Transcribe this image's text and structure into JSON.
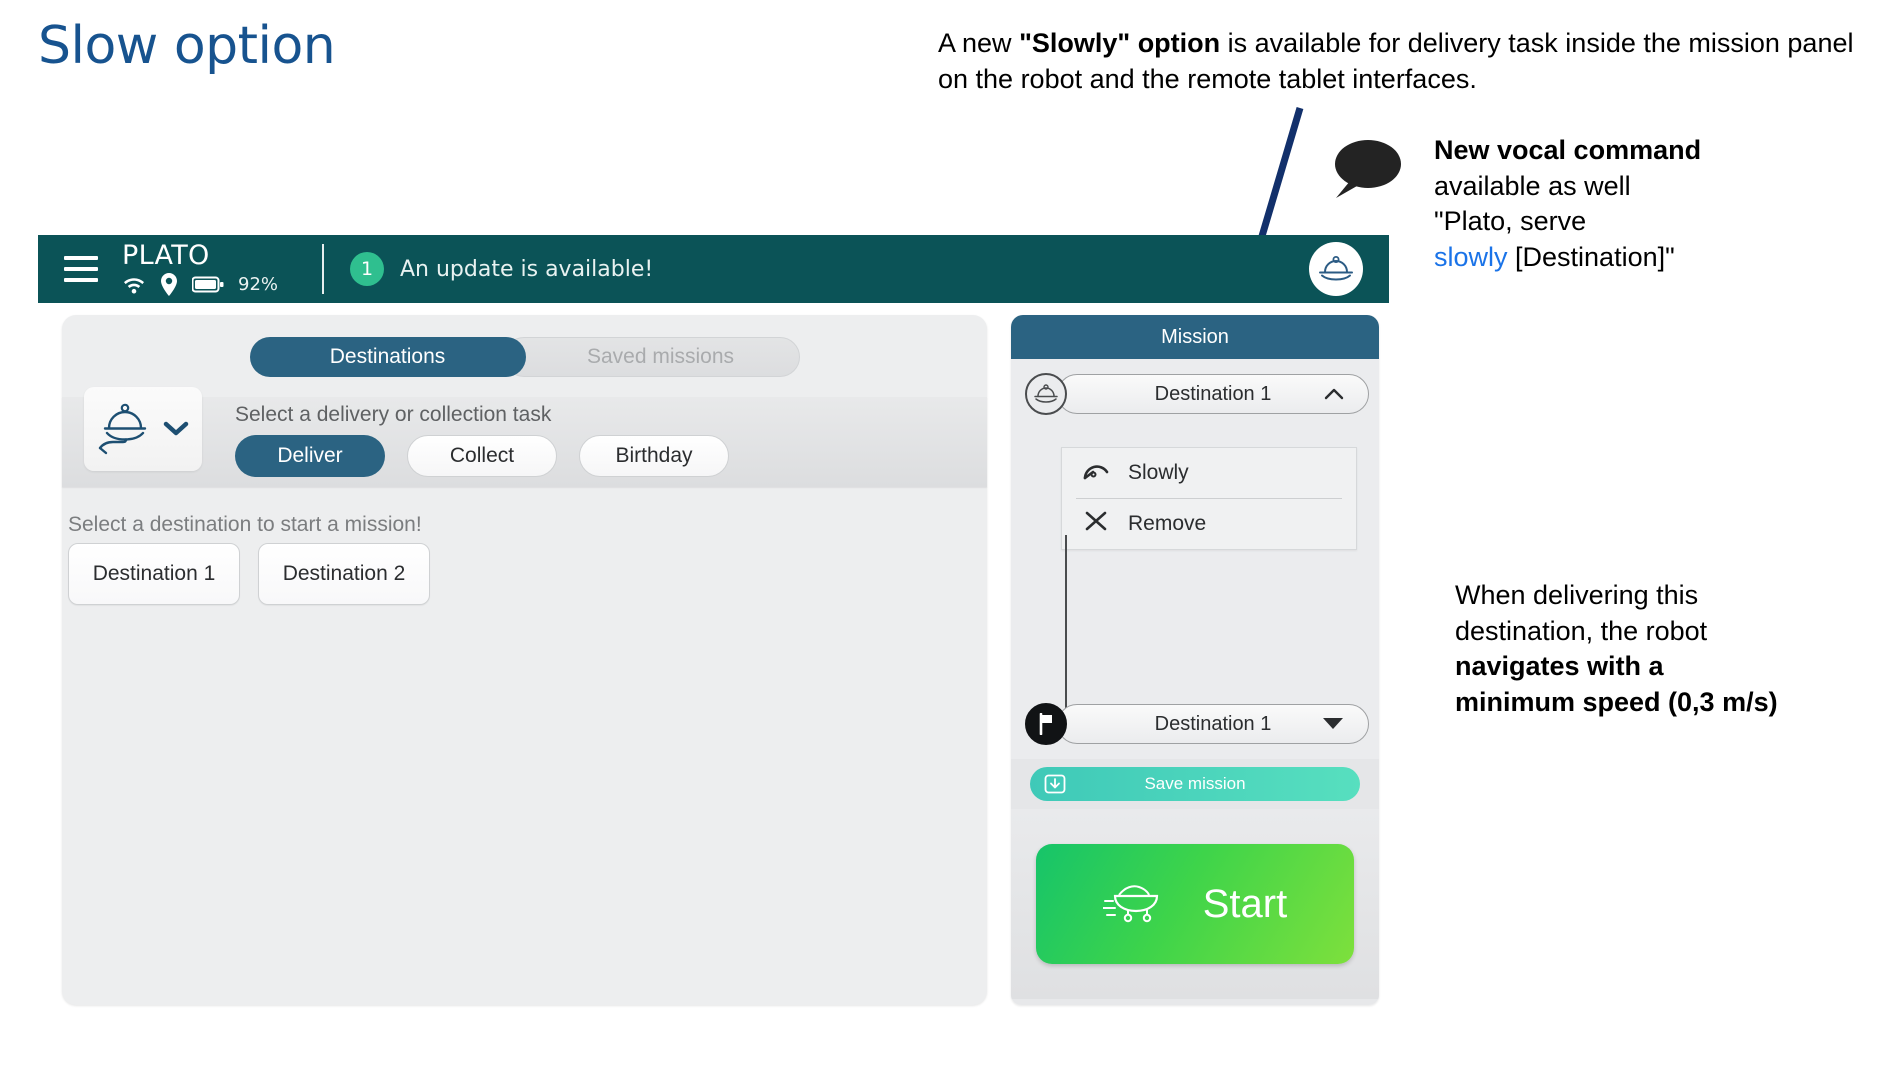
{
  "slide": {
    "title": "Slow option",
    "title_color": "#17538f"
  },
  "annotations": {
    "top_note": {
      "prefix": "A new ",
      "bold": "\"Slowly\" option",
      "suffix": " is available for delivery task inside the mission panel on the robot and the remote tablet interfaces."
    },
    "vocal_note": {
      "icon": "speech-bubble-icon",
      "line1_bold": "New vocal command",
      "line2": "available as well",
      "line3": "\"Plato, serve",
      "line4_blue": "slowly",
      "line4_rest": " [Destination]\"",
      "blue_color": "#1a73e8"
    },
    "bottom_note": {
      "line1": "When delivering this",
      "line2": "destination, the robot",
      "line3_bold": "navigates with a",
      "line4_bold": "minimum speed (0,3 m/s)"
    },
    "arrow": {
      "color": "#12306b",
      "name": "pointer-arrow"
    }
  },
  "app": {
    "header": {
      "menu_icon": "hamburger-menu-icon",
      "brand": "PLATO",
      "wifi_icon": "wifi-icon",
      "location_icon": "location-pin-icon",
      "battery_icon": "battery-icon",
      "battery_level": "92%",
      "update_count": "1",
      "update_text": "An update is available!",
      "avatar_icon": "serving-tray-icon",
      "bg_color": "#0b5357",
      "badge_color": "#2fbf8f"
    },
    "tabs": [
      {
        "label": "Destinations",
        "active": true
      },
      {
        "label": "Saved missions",
        "active": false
      }
    ],
    "task_selector": {
      "icon": "hand-serving-tray-icon",
      "chevron": "chevron-down-icon",
      "label": "Select a delivery or collection task",
      "options": [
        {
          "label": "Deliver",
          "selected": true
        },
        {
          "label": "Collect",
          "selected": false
        },
        {
          "label": "Birthday",
          "selected": false
        }
      ]
    },
    "destinations": {
      "hint": "Select a destination to start a mission!",
      "buttons": [
        {
          "label": "Destination 1"
        },
        {
          "label": "Destination 2"
        }
      ]
    },
    "mission_panel": {
      "title": "Mission",
      "title_bg": "#2b6382",
      "start_node": {
        "icon": "serving-tray-node-icon",
        "label": "Destination 1",
        "chevron": "chevron-up-icon"
      },
      "submenu": [
        {
          "label": "Slowly",
          "icon": "speedometer-icon"
        },
        {
          "label": "Remove",
          "icon": "close-x-icon"
        }
      ],
      "end_node": {
        "icon": "flag-icon",
        "label": "Destination 1",
        "chevron": "chevron-down-icon"
      },
      "save_button": {
        "label": "Save mission",
        "icon": "download-icon",
        "color": "#3fc9b8"
      },
      "start_button": {
        "label": "Start",
        "icon": "food-cart-icon",
        "color": "#3ed44a"
      }
    }
  }
}
